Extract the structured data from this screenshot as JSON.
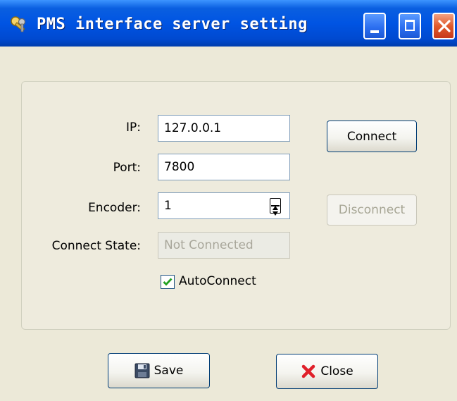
{
  "window": {
    "title": "PMS interface server setting"
  },
  "form": {
    "ip": {
      "label": "IP:",
      "value": "127.0.0.1"
    },
    "port": {
      "label": "Port:",
      "value": "7800"
    },
    "encoder": {
      "label": "Encoder:",
      "value": "1"
    },
    "connect_state": {
      "label": "Connect State:",
      "value": "Not Connected"
    },
    "autoconnect": {
      "label": "AutoConnect",
      "checked": true
    }
  },
  "buttons": {
    "connect": "Connect",
    "disconnect": "Disconnect",
    "save": "Save",
    "close": "Close"
  },
  "icons": {
    "app": "keys-icon",
    "save": "floppy-disk-icon",
    "close": "red-x-icon",
    "check": "checkmark-icon"
  },
  "colors": {
    "titlebar": "#0054e3",
    "dialog_bg": "#ece9d8",
    "close_button": "#e05a2c",
    "check": "#21a121",
    "close_icon": "#e0202a"
  }
}
